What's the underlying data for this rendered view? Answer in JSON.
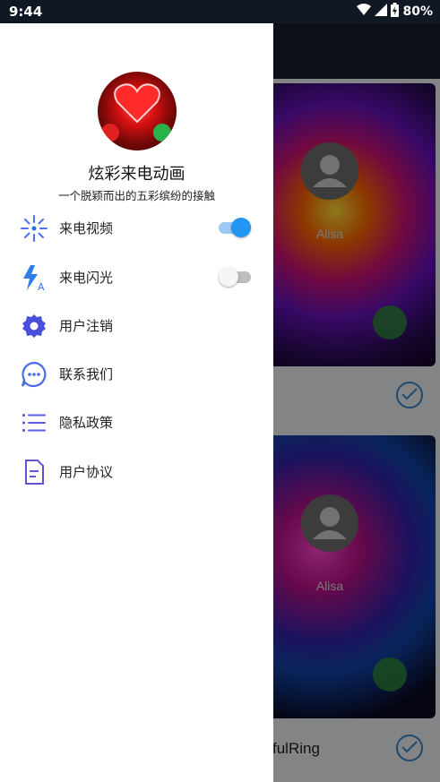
{
  "status_bar": {
    "time": "9:44",
    "battery": "80%",
    "icons": [
      "wifi-icon",
      "cell-signal-icon",
      "battery-icon"
    ]
  },
  "drawer": {
    "app_name": "炫彩来电动画",
    "slogan": "一个脱颖而出的五彩缤纷的接触",
    "menu": [
      {
        "label": "来电视频",
        "icon": "sparkle-icon",
        "toggle": true,
        "toggle_on": true
      },
      {
        "label": "来电闪光",
        "icon": "flash-icon",
        "toggle": true,
        "toggle_on": false
      },
      {
        "label": "用户注销",
        "icon": "gear-icon"
      },
      {
        "label": "联系我们",
        "icon": "chat-bubble-icon"
      },
      {
        "label": "隐私政策",
        "icon": "list-icon"
      },
      {
        "label": "用户协议",
        "icon": "document-icon"
      }
    ]
  },
  "background": {
    "cards": [
      {
        "caller": "Alisa",
        "selected": true
      },
      {
        "caller": "Alisa",
        "selected": true,
        "label": "fulRing"
      }
    ]
  },
  "colors": {
    "accent": "#2196f3",
    "icon_purple": "#5b4ee8",
    "drawer_bg": "#ffffff"
  }
}
